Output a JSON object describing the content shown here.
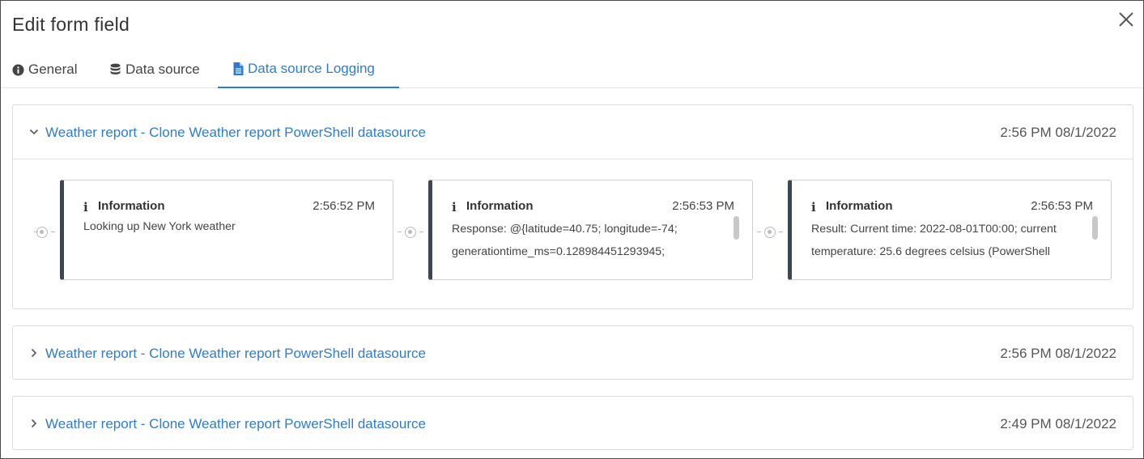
{
  "dialog": {
    "title": "Edit form field"
  },
  "tabs": [
    {
      "label": "General",
      "icon": "info-circle-icon"
    },
    {
      "label": "Data source",
      "icon": "database-icon"
    },
    {
      "label": "Data source Logging",
      "icon": "file-text-icon",
      "active": true
    }
  ],
  "colors": {
    "accent": "#2f7bd4",
    "card_border": "#3a4754"
  },
  "panels": [
    {
      "title": "Weather report - Clone Weather report PowerShell datasource",
      "time": "2:56 PM 08/1/2022",
      "expanded": true,
      "entries": [
        {
          "level": "Information",
          "time": "2:56:52 PM",
          "message_line1": "Looking up New York weather",
          "message_line2": ""
        },
        {
          "level": "Information",
          "time": "2:56:53 PM",
          "message_line1": "Response: @{latitude=40.75; longitude=-74;",
          "message_line2": "generationtime_ms=0.128984451293945;"
        },
        {
          "level": "Information",
          "time": "2:56:53 PM",
          "message_line1": "Result: Current time: 2022-08-01T00:00; current",
          "message_line2": "temperature: 25.6 degrees celsius (PowerShell"
        }
      ]
    },
    {
      "title": "Weather report - Clone Weather report PowerShell datasource",
      "time": "2:56 PM 08/1/2022",
      "expanded": false
    },
    {
      "title": "Weather report - Clone Weather report PowerShell datasource",
      "time": "2:49 PM 08/1/2022",
      "expanded": false
    }
  ]
}
